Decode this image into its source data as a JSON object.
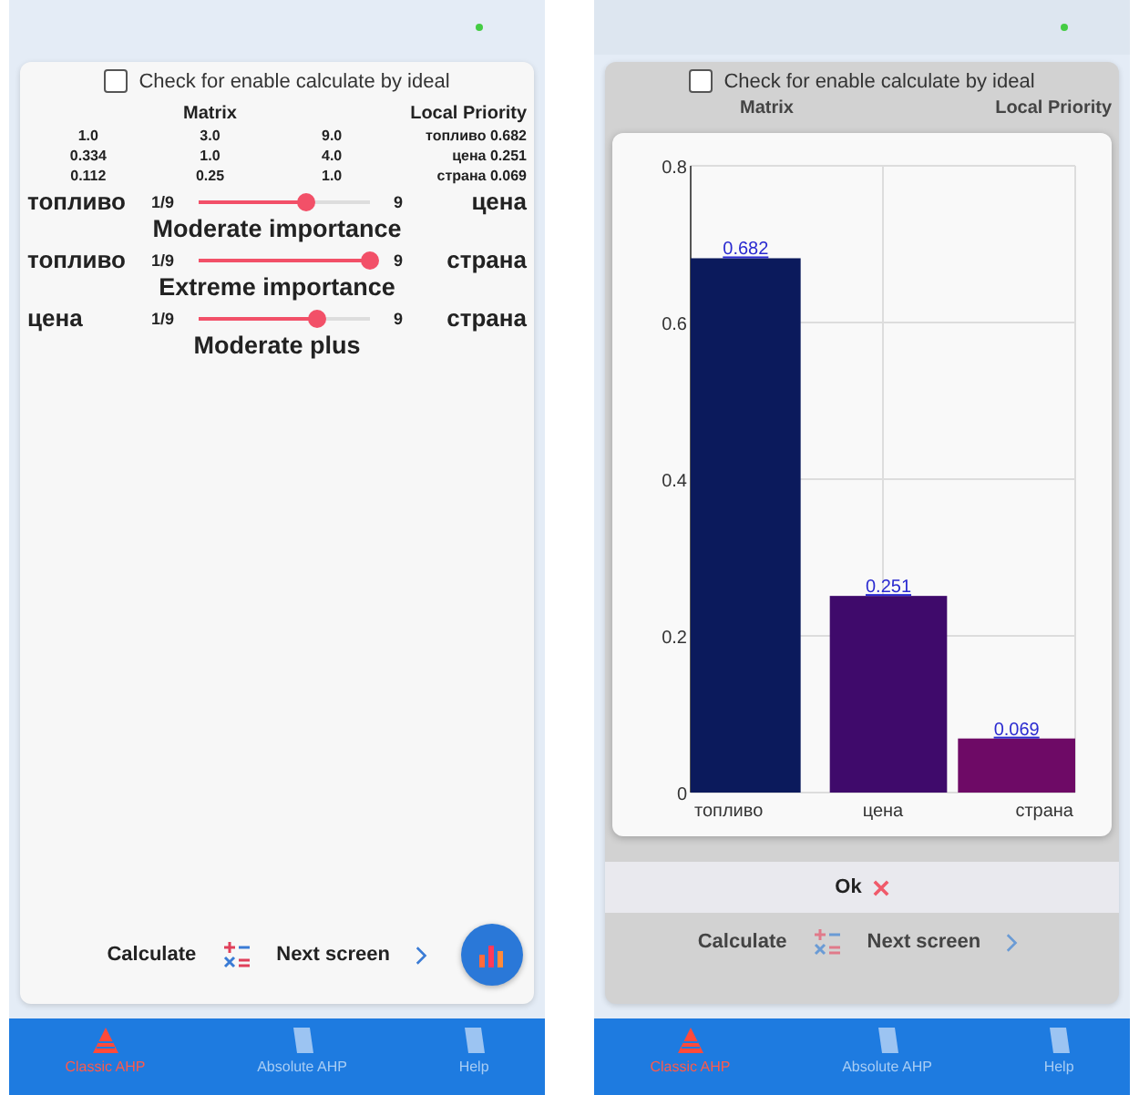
{
  "left_screen": {
    "ideal_checkbox": {
      "label": "Check for enable calculate by ideal",
      "checked": false
    },
    "matrix": {
      "title": "Matrix",
      "rows": [
        [
          "1.0",
          "3.0",
          "9.0"
        ],
        [
          "0.334",
          "1.0",
          "4.0"
        ],
        [
          "0.112",
          "0.25",
          "1.0"
        ]
      ]
    },
    "local_priority": {
      "title": "Local Priority",
      "rows": [
        {
          "name": "топливо",
          "value": "0.682"
        },
        {
          "name": "цена",
          "value": "0.251"
        },
        {
          "name": "страна",
          "value": "0.069"
        }
      ]
    },
    "comparisons": [
      {
        "left": "топливо",
        "min": "1/9",
        "max": "9",
        "right": "цена",
        "level": 0.625,
        "verdict": "Moderate importance"
      },
      {
        "left": "топливо",
        "min": "1/9",
        "max": "9",
        "right": "страна",
        "level": 1.0,
        "verdict": "Extreme importance"
      },
      {
        "left": "цена",
        "min": "1/9",
        "max": "9",
        "right": "страна",
        "level": 0.69,
        "verdict": "Moderate plus"
      }
    ],
    "actions": {
      "calculate": "Calculate",
      "next": "Next screen"
    },
    "nav": [
      {
        "label": "Classic AHP",
        "selected": true
      },
      {
        "label": "Absolute AHP",
        "selected": false
      },
      {
        "label": "Help",
        "selected": false
      }
    ]
  },
  "right_screen": {
    "ideal_checkbox": {
      "label": "Check for enable calculate by ideal",
      "checked": false
    },
    "matrix_title": "Matrix",
    "local_priority_title": "Local Priority",
    "dialog": {
      "chart_data": {
        "type": "bar",
        "categories": [
          "топливо",
          "цена",
          "страна"
        ],
        "series": [
          {
            "values": [
              0.682,
              0.251,
              0.069
            ]
          }
        ],
        "colors": [
          "#0b1a5c",
          "#3f0a6b",
          "#6e0a66"
        ],
        "ylim": [
          0,
          0.8
        ],
        "yticks": [
          0,
          0.2,
          0.4,
          0.6,
          0.8
        ],
        "grid": true,
        "data_labels": true
      },
      "ok": "Ok"
    },
    "actions": {
      "calculate": "Calculate",
      "next": "Next screen"
    },
    "nav": [
      {
        "label": "Classic AHP",
        "selected": true
      },
      {
        "label": "Absolute AHP",
        "selected": false
      },
      {
        "label": "Help",
        "selected": false
      }
    ]
  }
}
